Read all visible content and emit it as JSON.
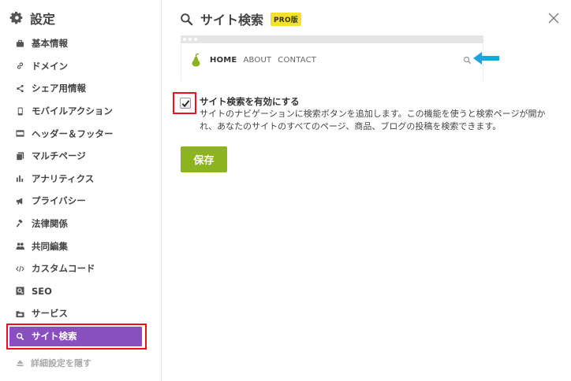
{
  "sidebar": {
    "title": "設定",
    "items": [
      {
        "label": "基本情報",
        "icon": "briefcase-icon"
      },
      {
        "label": "ドメイン",
        "icon": "link-icon"
      },
      {
        "label": "シェア用情報",
        "icon": "share-icon"
      },
      {
        "label": "モバイルアクション",
        "icon": "mobile-icon"
      },
      {
        "label": "ヘッダー＆フッター",
        "icon": "layout-icon"
      },
      {
        "label": "マルチページ",
        "icon": "pages-icon"
      },
      {
        "label": "アナリティクス",
        "icon": "bar-chart-icon"
      },
      {
        "label": "プライバシー",
        "icon": "megaphone-icon"
      },
      {
        "label": "法律関係",
        "icon": "gavel-icon"
      },
      {
        "label": "共同編集",
        "icon": "users-icon"
      },
      {
        "label": "カスタムコード",
        "icon": "code-icon"
      },
      {
        "label": "SEO",
        "icon": "seo-icon"
      },
      {
        "label": "サービス",
        "icon": "folder-icon"
      },
      {
        "label": "サイト検索",
        "icon": "search-icon"
      }
    ],
    "active_index": 13,
    "active_color": "#8a4fbf",
    "hide_label": "詳細設定を隠す"
  },
  "main": {
    "title": "サイト検索",
    "badge": "PRO版",
    "badge_color": "#f4e12a",
    "preview": {
      "menu": [
        "HOME",
        "ABOUT",
        "CONTACT"
      ],
      "arrow_color": "#1aa5dd",
      "logo_color": "#8db31f"
    },
    "checkbox": {
      "checked": true,
      "label": "サイト検索を有効にする",
      "description": "サイトのナビゲーションに検索ボタンを追加します。この機能を使うと検索ページが開かれ、あなたのサイトのすべてのページ、商品、ブログの投稿を検索できます。"
    },
    "save_label": "保存",
    "save_color": "#8db31f",
    "highlight_color": "#e8111d"
  }
}
